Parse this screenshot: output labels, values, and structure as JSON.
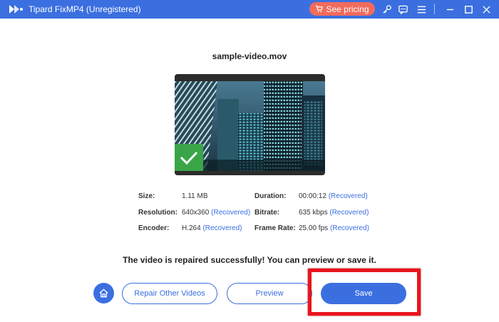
{
  "window": {
    "title": "Tipard FixMP4 (Unregistered)",
    "pricing_label": "See pricing",
    "accent_color": "#3b6fe0",
    "pricing_color": "#f26b5b"
  },
  "video": {
    "filename": "sample-video.mov",
    "status_color": "#3aa548"
  },
  "info": {
    "size_label": "Size:",
    "size_value": "1.11 MB",
    "duration_label": "Duration:",
    "duration_value": "00:00:12",
    "duration_status": "(Recovered)",
    "resolution_label": "Resolution:",
    "resolution_value": "640x360",
    "resolution_status": "(Recovered)",
    "bitrate_label": "Bitrate:",
    "bitrate_value": "635 kbps",
    "bitrate_status": "(Recovered)",
    "encoder_label": "Encoder:",
    "encoder_value": "H.264",
    "encoder_status": "(Recovered)",
    "framerate_label": "Frame Rate:",
    "framerate_value": "25.00 fps",
    "framerate_status": "(Recovered)"
  },
  "message": "The video is repaired successfully! You can preview or save it.",
  "actions": {
    "repair_other": "Repair Other Videos",
    "preview": "Preview",
    "save": "Save"
  }
}
